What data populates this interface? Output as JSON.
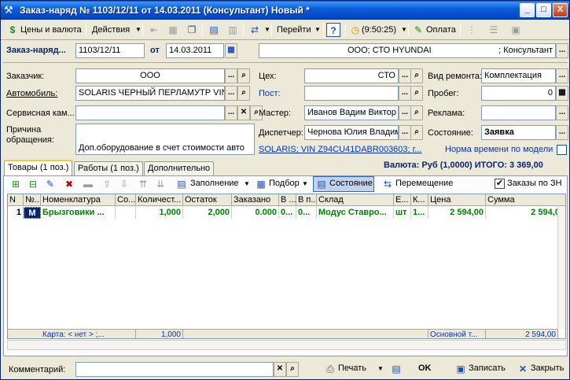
{
  "window": {
    "title": "Заказ-наряд № 1103/12/11 от 14.03.2011 (Консультант) Новый *",
    "minimize": "_",
    "maximize": "□",
    "close": "X"
  },
  "toolbar": {
    "prices": "Цены и валюта",
    "actions": "Действия",
    "goto": "Перейти",
    "help": "?",
    "time": "(9:50:25)",
    "payment": "Оплата"
  },
  "header": {
    "doc_label": "Заказ-наряд...",
    "doc_number": "1103/12/11",
    "from_label": "от",
    "doc_date": "14.03.2011",
    "org_text": "ООО; СТО HYUNDAI",
    "org_right": "; Консультант"
  },
  "form": {
    "customer_label": "Заказчик:",
    "customer_value": "ООО",
    "car_label": "Автомобиль:",
    "car_value": "SOLARIS ЧЕРНЫЙ ПЕРЛАМУТР VIN",
    "service_card_label": "Сервисная кам...",
    "service_card_value": "",
    "reason_label1": "Причина",
    "reason_label2": "обращения:",
    "reason_value": "Доп.оборудование в счет стоимости авто",
    "shop_label": "Цех:",
    "shop_value": "СТО",
    "post_label": "Пост:",
    "post_value": "",
    "master_label": "Мастер:",
    "master_value": "Иванов Вадим Виктор",
    "dispatcher_label": "Диспетчер:",
    "dispatcher_value": "Чернова Юлия Владим",
    "car_link": "SOLARIS; VIN Z94CU41DABR003603; г...",
    "repair_type_label": "Вид ремонта:",
    "repair_type_value": "Комплектация",
    "mileage_label": "Пробег:",
    "mileage_value": "0",
    "ads_label": "Реклама:",
    "ads_value": "",
    "state_label": "Состояние:",
    "state_value": "Заявка",
    "norm_label": "Норма времени по модели",
    "currency_total": "Валюта: Руб (1,0000) ИТОГО: 3 369,00"
  },
  "tabs": [
    {
      "label": "Товары (1 поз.)"
    },
    {
      "label": "Работы (1 поз.)"
    },
    {
      "label": "Дополнительно"
    }
  ],
  "tab_toolbar": {
    "fill": "Заполнение",
    "select": "Подбор",
    "state": "Состояние",
    "move": "Перемещение",
    "orders_zn": "Заказы по ЗН"
  },
  "table": {
    "headers": [
      "N",
      "№...",
      "Номенклатура",
      "Со...",
      "Количест...",
      "Остаток",
      "Заказано",
      "В ...",
      "В п...",
      "Склад",
      "Е...",
      "К...",
      "Цена",
      "Сумма"
    ],
    "rows": [
      {
        "n": "1",
        "no": "M",
        "name": "Брызговики ...",
        "co": "",
        "qty": "1,000",
        "rest": "2,000",
        "ordered": "0.000",
        "v1": "0...",
        "v2": "0...",
        "warehouse": "Модус Ставро...",
        "unit": "шт",
        "k": "1...",
        "price": "2 594,00",
        "sum": "2 594,00"
      }
    ],
    "footer": {
      "card": "Карта: < нет > ;...",
      "qty_total": "1,000",
      "warehouse_total": "Основной т...",
      "sum_total": "2 594,00"
    }
  },
  "bottom": {
    "comment_label": "Комментарий:",
    "comment_value": "",
    "print": "Печать",
    "ok": "OK",
    "save": "Записать",
    "close": "Закрыть"
  }
}
